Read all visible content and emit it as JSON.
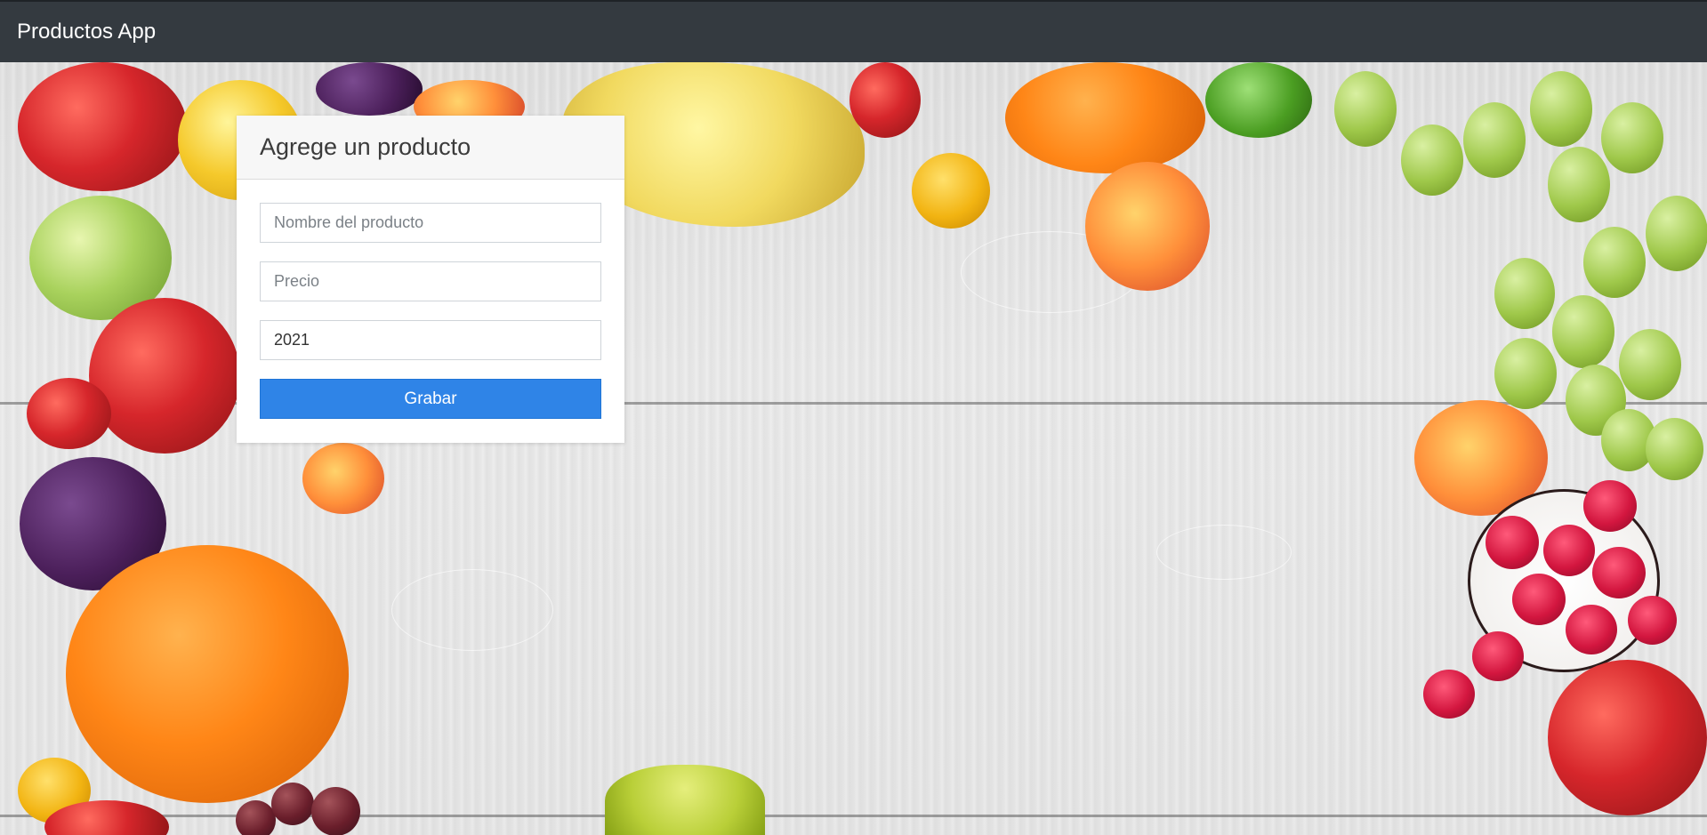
{
  "navbar": {
    "brand": "Productos App",
    "background": "#343a40"
  },
  "form": {
    "title": "Agrege un producto",
    "fields": [
      {
        "placeholder": "Nombre del producto",
        "value": ""
      },
      {
        "placeholder": "Precio",
        "value": ""
      },
      {
        "placeholder": "",
        "value": "2021"
      }
    ],
    "submit_label": "Grabar",
    "submit_color": "#2f84e7"
  }
}
